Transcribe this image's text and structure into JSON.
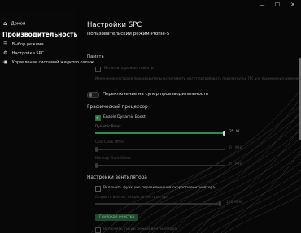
{
  "window": {
    "minimize": "—",
    "maximize": "☐",
    "close": "✕"
  },
  "sidebar": {
    "home_label": "Домой",
    "title": "Производительность",
    "items": [
      {
        "label": "Выбор режима",
        "icon": "list-icon"
      },
      {
        "label": "Настройки SPC",
        "icon": "gear-icon"
      },
      {
        "label": "Управление системой жидкого охлаж",
        "icon": "liquid-cooling-icon"
      }
    ]
  },
  "main": {
    "title": "Настройки SPC",
    "subtitle": "Пользовательский режим Profile-5",
    "memory": {
      "heading": "Память",
      "checkbox_label": "Включить режим памяти",
      "note": "Изменение настроек производительности памяти могут потребовать перезагрузки ПК для применения изменений"
    },
    "super_perf": {
      "label": "Переключение на супер производительность",
      "on": false
    },
    "gpu": {
      "heading": "Графический процессор",
      "dynamic_boost_check": "Enable Dynamic Boost",
      "dynamic_boost_label": "Dynamic Boost",
      "dynamic_boost_value": "25",
      "dynamic_boost_unit": "W",
      "core_clock_label": "Core Clock Offset",
      "core_clock_value": "0",
      "core_clock_unit": "MHz",
      "memory_clock_label": "Memory Clock Offset",
      "memory_clock_value": "0",
      "memory_clock_unit": "MHz"
    },
    "fan": {
      "heading": "Настройки вентилятора",
      "enable_label": "Включить функцию перевключения скорости вентилятора",
      "max_speed_label": "Скорость вентил. скорости вентилятора",
      "max_speed_value": "100",
      "max_speed_unit": "RPM",
      "button_label": "Глубокая очистка",
      "silent_label": "Включить тихий режим вентилятора"
    }
  },
  "colors": {
    "accent": "#2f8b52",
    "background": "#070707",
    "text": "#e8e8e8"
  }
}
